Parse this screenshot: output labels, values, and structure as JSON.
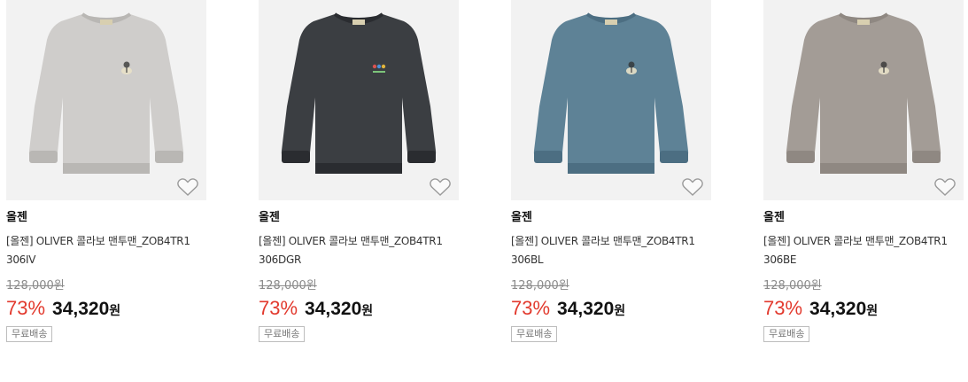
{
  "products": [
    {
      "brand": "올젠",
      "title_line1": "[올젠] OLIVER 콜라보 맨투맨_ZOB4TR1",
      "title_line2": "306IV",
      "original_price": "128,000원",
      "discount": "73%",
      "price": "34,320",
      "currency": "원",
      "shipping_badge": "무료배송",
      "color": "#cfcdcb",
      "shade": "#b9b7b4",
      "logo": "character"
    },
    {
      "brand": "올젠",
      "title_line1": "[올젠] OLIVER 콜라보 맨투맨_ZOB4TR1",
      "title_line2": "306DGR",
      "original_price": "128,000원",
      "discount": "73%",
      "price": "34,320",
      "currency": "원",
      "shipping_badge": "무료배송",
      "color": "#3b3e42",
      "shade": "#2a2c30",
      "logo": "dots"
    },
    {
      "brand": "올젠",
      "title_line1": "[올젠] OLIVER 콜라보 맨투맨_ZOB4TR1",
      "title_line2": "306BL",
      "original_price": "128,000원",
      "discount": "73%",
      "price": "34,320",
      "currency": "원",
      "shipping_badge": "무료배송",
      "color": "#5e8296",
      "shade": "#4c6e82",
      "logo": "character"
    },
    {
      "brand": "올젠",
      "title_line1": "[올젠] OLIVER 콜라보 맨투맨_ZOB4TR1",
      "title_line2": "306BE",
      "original_price": "128,000원",
      "discount": "73%",
      "price": "34,320",
      "currency": "원",
      "shipping_badge": "무료배송",
      "color": "#a39c96",
      "shade": "#8f8882",
      "logo": "character"
    }
  ],
  "icons": {
    "wishlist": "heart-outline-icon"
  }
}
